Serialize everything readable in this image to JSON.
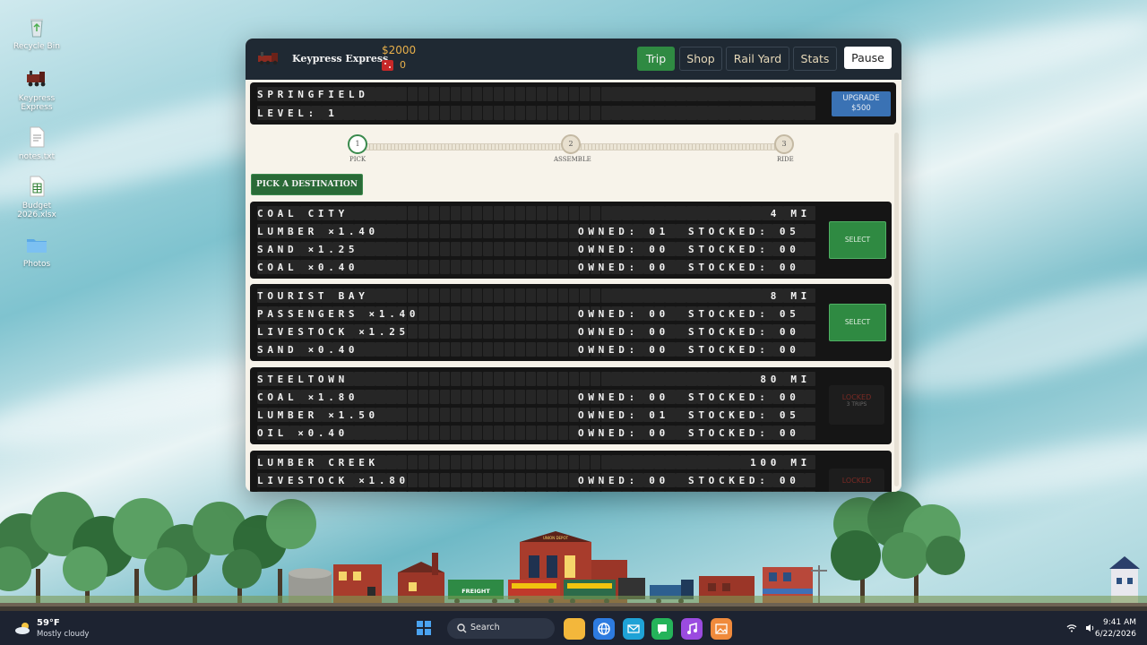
{
  "desktop": {
    "icons": [
      {
        "label": "Recycle Bin",
        "icon": "recycle-bin-icon"
      },
      {
        "label": "Keypress Express",
        "icon": "train-icon"
      },
      {
        "label": "notes.txt",
        "icon": "text-file-icon"
      },
      {
        "label": "Budget 2026.xlsx",
        "icon": "spreadsheet-icon"
      },
      {
        "label": "Photos",
        "icon": "folder-icon"
      }
    ]
  },
  "game": {
    "title": "Keypress Express",
    "money": "$2000",
    "tickets": "0",
    "nav": [
      {
        "label": "Trip",
        "active": true
      },
      {
        "label": "Shop",
        "active": false
      },
      {
        "label": "Rail Yard",
        "active": false
      },
      {
        "label": "Stats",
        "active": false
      }
    ],
    "pause_label": "Pause",
    "station": {
      "name": "SPRINGFIELD",
      "level": "LEVEL: 1"
    },
    "upgrade": {
      "label": "UPGRADE",
      "cost": "$500"
    },
    "steps": [
      {
        "num": "1",
        "label": "PICK"
      },
      {
        "num": "2",
        "label": "ASSEMBLE"
      },
      {
        "num": "3",
        "label": "RIDE"
      }
    ],
    "pick_label": "PICK A DESTINATION",
    "destinations": [
      {
        "name": "COAL CITY",
        "distance": "4 MI",
        "rows": [
          {
            "good": "LUMBER ×1.40",
            "owned": "OWNED: 01",
            "stocked": "STOCKED: 05"
          },
          {
            "good": "SAND ×1.25",
            "owned": "OWNED: 00",
            "stocked": "STOCKED: 00"
          },
          {
            "good": "COAL ×0.40",
            "owned": "OWNED: 00",
            "stocked": "STOCKED: 00"
          }
        ],
        "action": "SELECT"
      },
      {
        "name": "TOURIST BAY",
        "distance": "8 MI",
        "rows": [
          {
            "good": "PASSENGERS ×1.40",
            "owned": "OWNED: 00",
            "stocked": "STOCKED: 05"
          },
          {
            "good": "LIVESTOCK ×1.25",
            "owned": "OWNED: 00",
            "stocked": "STOCKED: 00"
          },
          {
            "good": "SAND ×0.40",
            "owned": "OWNED: 00",
            "stocked": "STOCKED: 00"
          }
        ],
        "action": "SELECT"
      },
      {
        "name": "STEELTOWN",
        "distance": "80 MI",
        "rows": [
          {
            "good": "COAL ×1.80",
            "owned": "OWNED: 00",
            "stocked": "STOCKED: 00"
          },
          {
            "good": "LUMBER ×1.50",
            "owned": "OWNED: 01",
            "stocked": "STOCKED: 05"
          },
          {
            "good": "OIL ×0.40",
            "owned": "OWNED: 00",
            "stocked": "STOCKED: 00"
          }
        ],
        "action": "LOCKED",
        "action_sub": "3 TRIPS"
      },
      {
        "name": "LUMBER CREEK",
        "distance": "100 MI",
        "rows": [
          {
            "good": "LIVESTOCK ×1.80",
            "owned": "OWNED: 00",
            "stocked": "STOCKED: 00"
          }
        ],
        "action": "LOCKED"
      }
    ]
  },
  "scene": {
    "freight_car_label": "FREIGHT",
    "depot_sign": "UNION DEPOT"
  },
  "taskbar": {
    "weather_temp": "59°F",
    "weather_desc": "Mostly cloudy",
    "search_label": "Search",
    "time": "9:41 AM",
    "date": "6/22/2026",
    "apps": [
      "file-explorer-icon",
      "browser-icon",
      "mail-icon",
      "chat-icon",
      "music-icon",
      "photos-icon"
    ]
  }
}
